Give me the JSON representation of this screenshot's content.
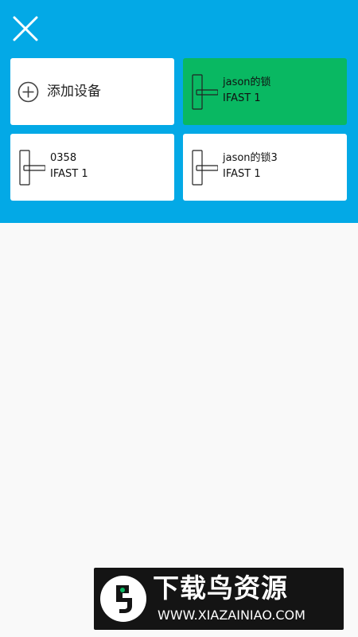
{
  "header": {
    "close_icon": "close-icon",
    "background_color": "#03a9e6"
  },
  "add_device": {
    "label": "添加设备",
    "icon": "plus-circle-icon"
  },
  "devices": [
    {
      "name": "jason的锁",
      "model": "IFAST 1",
      "selected": true,
      "icon": "door-lock-icon"
    },
    {
      "name": "0358",
      "model": "IFAST 1",
      "selected": false,
      "icon": "door-lock-icon"
    },
    {
      "name": "jason的锁3",
      "model": "IFAST 1",
      "selected": false,
      "icon": "door-lock-icon"
    }
  ],
  "colors": {
    "selected_card": "#09b862",
    "card": "#ffffff"
  },
  "watermark": {
    "brand": "下载鸟资源",
    "url": "WWW.XIAZAINIAO.COM"
  }
}
